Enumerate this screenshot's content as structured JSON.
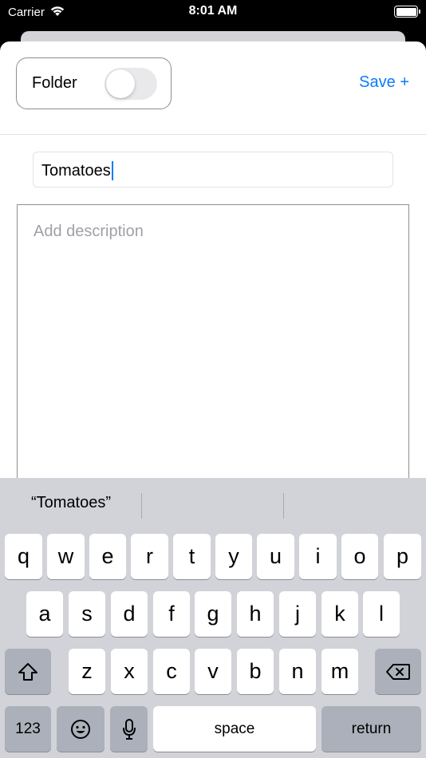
{
  "status_bar": {
    "carrier": "Carrier",
    "time": "8:01 AM"
  },
  "header": {
    "folder_label": "Folder",
    "folder_toggle_on": false,
    "save_label": "Save +"
  },
  "title_field": {
    "value": "Tomatoes"
  },
  "description": {
    "placeholder": "Add description",
    "value": ""
  },
  "keyboard": {
    "suggestions": [
      "“Tomatoes”",
      "",
      ""
    ],
    "row1": [
      "q",
      "w",
      "e",
      "r",
      "t",
      "y",
      "u",
      "i",
      "o",
      "p"
    ],
    "row2": [
      "a",
      "s",
      "d",
      "f",
      "g",
      "h",
      "j",
      "k",
      "l"
    ],
    "row3": [
      "z",
      "x",
      "c",
      "v",
      "b",
      "n",
      "m"
    ],
    "numbers_label": "123",
    "space_label": "space",
    "return_label": "return"
  },
  "colors": {
    "accent": "#0a7aff",
    "keyboard_bg": "#d1d3d9",
    "key_dark": "#abb0ba"
  }
}
